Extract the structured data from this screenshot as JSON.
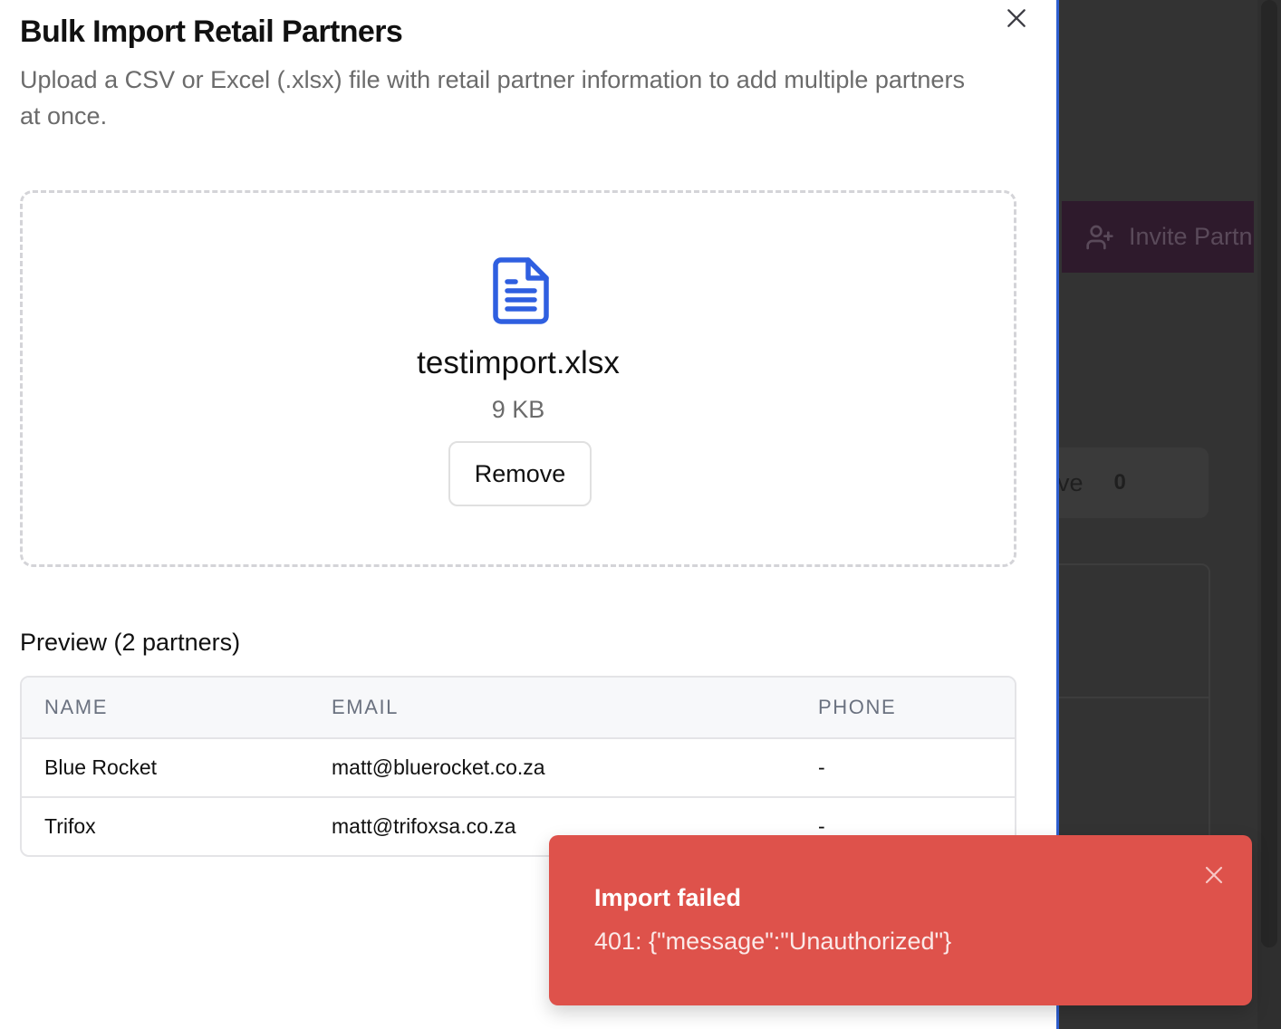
{
  "dialog": {
    "title": "Bulk Import Retail Partners",
    "description": "Upload a CSV or Excel (.xlsx) file with retail partner information to add multiple partners at once.",
    "close_icon": "close-icon"
  },
  "upload": {
    "file_icon": "file-text-icon",
    "file_name": "testimport.xlsx",
    "file_size": "9 KB",
    "remove_label": "Remove"
  },
  "preview": {
    "title": "Preview (2 partners)",
    "columns": [
      "NAME",
      "EMAIL",
      "PHONE"
    ],
    "rows": [
      [
        "Blue Rocket",
        "matt@bluerocket.co.za",
        "-"
      ],
      [
        "Trifox",
        "matt@trifoxsa.co.za",
        "-"
      ]
    ]
  },
  "toast": {
    "title": "Import failed",
    "message": "401: {\"message\":\"Unauthorized\"}",
    "close_icon": "close-icon",
    "color": "#de524b"
  },
  "background": {
    "invite_label": "Invite Partn",
    "stat_label": "ctive",
    "stat_count": "0"
  },
  "colors": {
    "accent": "#2f5fd0",
    "file_icon": "#2f5fe0",
    "error": "#de524b"
  }
}
